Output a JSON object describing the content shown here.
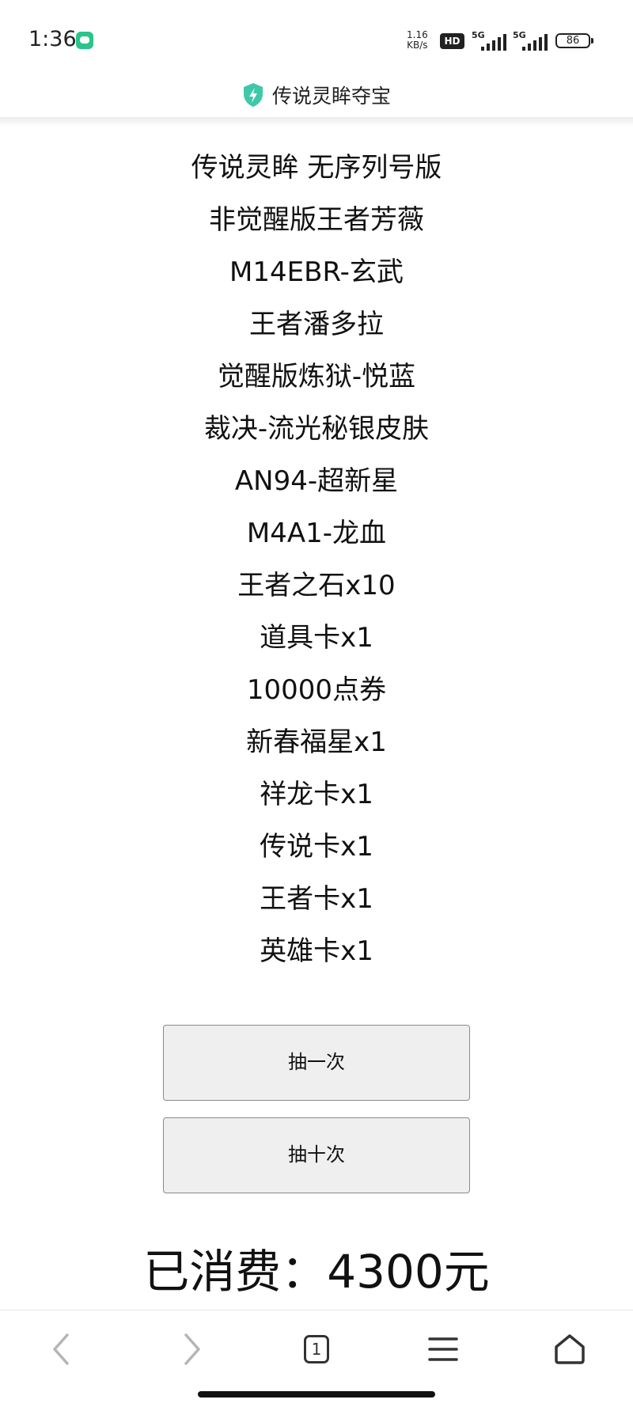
{
  "status_bar": {
    "time": "1:36",
    "net_speed_value": "1.16",
    "net_speed_unit": "KB/s",
    "hd_badge": "HD",
    "signal_1_label": "5G",
    "signal_2_label": "5G",
    "battery_level": "86",
    "app_notification_icon": "chat-bubble-icon"
  },
  "header": {
    "title": "传说灵眸夺宝",
    "icon": "shield-bolt-icon",
    "icon_color": "#3ec8a8"
  },
  "prizes": [
    "传说灵眸 无序列号版",
    "非觉醒版王者芳薇",
    "M14EBR-玄武",
    "王者潘多拉",
    "觉醒版炼狱-悦蓝",
    "裁决-流光秘银皮肤",
    "AN94-超新星",
    "M4A1-龙血",
    "王者之石x10",
    "道具卡x1",
    "10000点券",
    "新春福星x1",
    "祥龙卡x1",
    "传说卡x1",
    "王者卡x1",
    "英雄卡x1"
  ],
  "buttons": {
    "draw_once": "抽一次",
    "draw_ten": "抽十次"
  },
  "spent_text": "已消费：4300元",
  "bottom_nav": {
    "tab_count": "1",
    "items": [
      "back-icon",
      "forward-icon",
      "tabs-icon",
      "menu-icon",
      "home-icon"
    ]
  }
}
